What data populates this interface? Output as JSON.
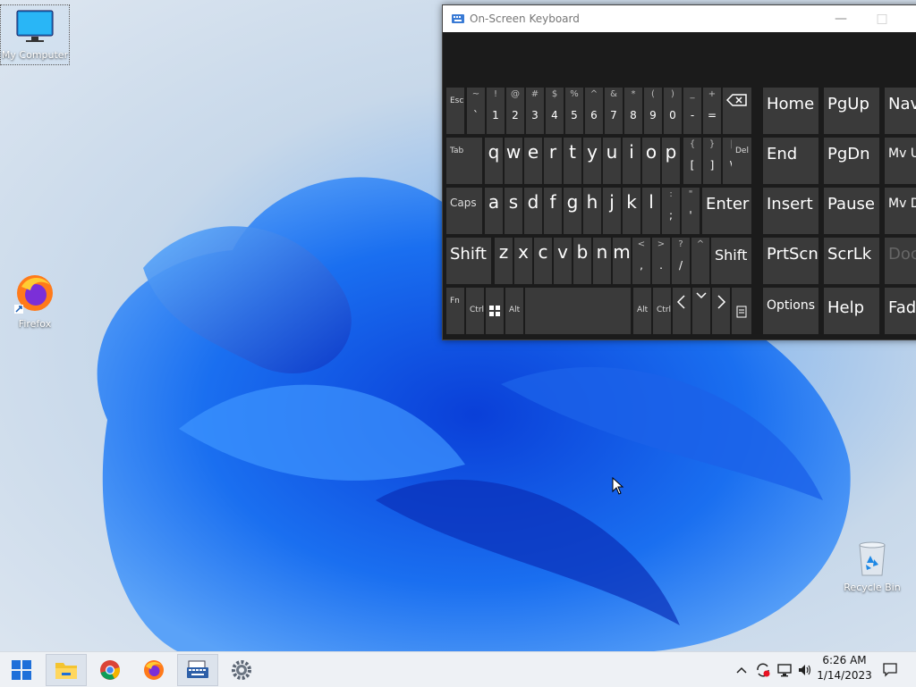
{
  "desktop": {
    "icons": [
      {
        "label": "My Computer"
      },
      {
        "label": "Firefox"
      },
      {
        "label": "Recycle Bin"
      }
    ]
  },
  "osk": {
    "title": "On-Screen Keyboard",
    "controls": {
      "minimize": "—",
      "maximize": "□"
    },
    "row1": [
      {
        "top": "~",
        "main": "`"
      },
      {
        "top": "!",
        "main": "1"
      },
      {
        "top": "@",
        "main": "2"
      },
      {
        "top": "#",
        "main": "3"
      },
      {
        "top": "$",
        "main": "4"
      },
      {
        "top": "%",
        "main": "5"
      },
      {
        "top": "^",
        "main": "6"
      },
      {
        "top": "&",
        "main": "7"
      },
      {
        "top": "*",
        "main": "8"
      },
      {
        "top": "(",
        "main": "9"
      },
      {
        "top": ")",
        "main": "0"
      },
      {
        "top": "_",
        "main": "-"
      },
      {
        "top": "+",
        "main": "="
      }
    ],
    "row2_letters": [
      "q",
      "w",
      "e",
      "r",
      "t",
      "y",
      "u",
      "i",
      "o",
      "p"
    ],
    "row2_sym": [
      {
        "top": "{",
        "main": "["
      },
      {
        "top": "}",
        "main": "]"
      },
      {
        "top": "|",
        "main": "\\"
      }
    ],
    "row3_letters": [
      "a",
      "s",
      "d",
      "f",
      "g",
      "h",
      "j",
      "k",
      "l"
    ],
    "row3_sym": [
      {
        "top": ":",
        "main": ";"
      },
      {
        "top": "\"",
        "main": "'"
      }
    ],
    "row4_letters": [
      "z",
      "x",
      "c",
      "v",
      "b",
      "n",
      "m"
    ],
    "row4_sym": [
      {
        "top": "<",
        "main": ","
      },
      {
        "top": ">",
        "main": "."
      },
      {
        "top": "?",
        "main": "/"
      }
    ],
    "keys": {
      "esc": "Esc",
      "tab": "Tab",
      "del": "Del",
      "caps": "Caps",
      "enter": "Enter",
      "shift": "Shift",
      "fn": "Fn",
      "ctrl": "Ctrl",
      "alt": "Alt"
    },
    "side": {
      "home": "Home",
      "pgup": "PgUp",
      "nav": "Nav",
      "end": "End",
      "pgdn": "PgDn",
      "mvup": "Mv U",
      "insert": "Insert",
      "pause": "Pause",
      "mvdn": "Mv D",
      "prtscn": "PrtScn",
      "scrlk": "ScrLk",
      "dock": "Doc",
      "options": "Options",
      "help": "Help",
      "fade": "Fad"
    }
  },
  "taskbar": {
    "apps": [
      "start",
      "file-explorer",
      "chrome",
      "firefox",
      "on-screen-keyboard",
      "settings"
    ],
    "clock": {
      "time": "6:26 AM",
      "date": "1/14/2023"
    }
  }
}
